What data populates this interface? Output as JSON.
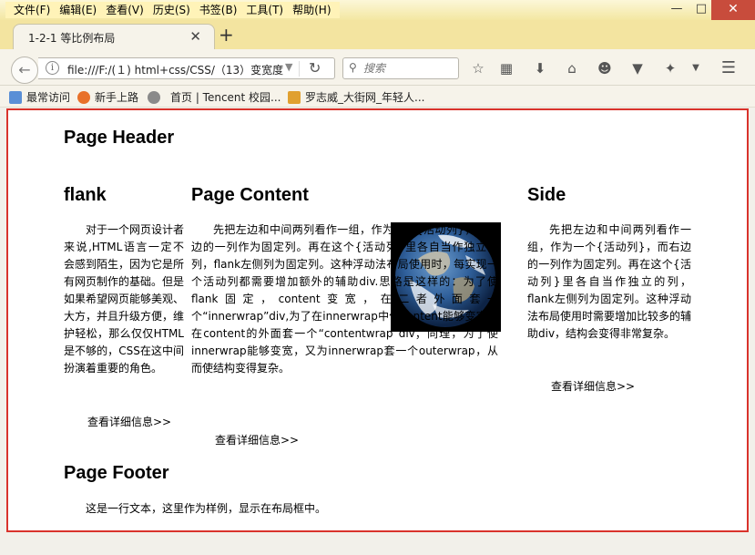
{
  "browser": {
    "menus": [
      "文件(F)",
      "编辑(E)",
      "查看(V)",
      "历史(S)",
      "书签(B)",
      "工具(T)",
      "帮助(H)"
    ],
    "tab_title": "1-2-1 等比例布局",
    "url": "file:///F:/(１) html+css/CSS/（13）变宽度",
    "search_placeholder": "搜索",
    "bookmarks": [
      "最常访问",
      "新手上路",
      "首页 | Tencent 校园...",
      "罗志威_大街网_年轻人..."
    ]
  },
  "page": {
    "header": "Page Header",
    "flank": {
      "title": "flank",
      "text": "对于一个网页设计者来说,HTML语言一定不会感到陌生，因为它是所有网页制作的基础。但是如果希望网页能够美观、大方，并且升级方便，维护轻松，那么仅仅HTML是不够的，CSS在这中间扮演着重要的角色。",
      "more": "查看详细信息>>"
    },
    "content": {
      "title": "Page Content",
      "text": "先把左边和中间两列看作一组，作为一个{活动列}，而右边的一列作为固定列。再在这个{活动列}里各自当作独立的列，flank左侧列为固定列。这种浮动法布局使用时，每实现一个活动列都需要增加额外的辅助div.思路是这样的：为了使flank固定，content变宽，在二者外面套一个“innerwrap”div,为了在innerwrap中使content能够变宽，在content的外面套一个“contentwrap”div；同理，为了使innerwrap能够变宽，又为innerwrap套一个outerwrap，从而使结构变得复杂。",
      "more": "查看详细信息>>"
    },
    "side": {
      "title": "Side",
      "text": "先把左边和中间两列看作一组，作为一个{活动列}，而右边的一列作为固定列。再在这个{活动列}里各自当作独立的列，flank左侧列为固定列。这种浮动法布局使用时需要增加比较多的辅助div，结构会变得非常复杂。",
      "more": "查看详细信息>>"
    },
    "footer": {
      "title": "Page Footer",
      "text": "这是一行文本，这里作为样例，显示在布局框中。"
    }
  }
}
